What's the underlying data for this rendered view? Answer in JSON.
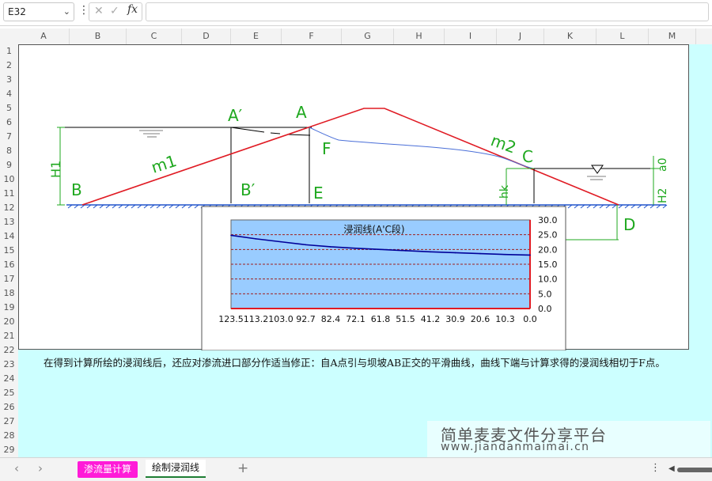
{
  "formula_bar": {
    "name_box": "E32",
    "fx": "fx",
    "cancel": "✕",
    "confirm": "✓",
    "more": "⋮",
    "content": ""
  },
  "columns": [
    "A",
    "B",
    "C",
    "D",
    "E",
    "F",
    "G",
    "H",
    "I",
    "J",
    "K",
    "L",
    "M"
  ],
  "rows": [
    "1",
    "2",
    "3",
    "4",
    "5",
    "6",
    "7",
    "8",
    "9",
    "10",
    "11",
    "12",
    "13",
    "14",
    "15",
    "16",
    "17",
    "18",
    "19",
    "20",
    "21",
    "22",
    "23",
    "24",
    "25",
    "26",
    "27",
    "28",
    "29"
  ],
  "diagram": {
    "labels": {
      "A_prime": "A′",
      "A": "A",
      "B": "B",
      "B_prime": "B′",
      "E": "E",
      "F": "F",
      "m1": "m1",
      "m2": "m2",
      "C": "C",
      "D": "D",
      "H1": "H1",
      "H2": "H2",
      "hk": "hk",
      "a0": "a0"
    },
    "colors": {
      "slope": "#e01b24",
      "seepage": "#4a6fd8",
      "annotation": "#1fa81f",
      "water": "#2255cc"
    }
  },
  "chart_data": {
    "type": "line",
    "title": "浸润线(A'C段)",
    "categories": [
      "123.5",
      "113.2",
      "103.0",
      "92.7",
      "82.4",
      "72.1",
      "61.8",
      "51.5",
      "41.2",
      "30.9",
      "20.6",
      "10.3",
      "0.0"
    ],
    "x": [
      123.5,
      113.2,
      103.0,
      92.7,
      82.4,
      72.1,
      61.8,
      51.5,
      41.2,
      30.9,
      20.6,
      10.3,
      0.0
    ],
    "series": [
      {
        "values": [
          24.8,
          23.6,
          22.6,
          21.6,
          20.9,
          20.4,
          20.0,
          19.6,
          19.2,
          18.9,
          18.6,
          18.3,
          18.1
        ]
      }
    ],
    "yticks": [
      "30.0",
      "25.0",
      "20.0",
      "15.0",
      "10.0",
      "5.0",
      "0.0"
    ],
    "ylim": [
      0,
      30
    ],
    "y_axis_side": "right",
    "grid": true,
    "plot_bg": "#99ccff",
    "line_color": "#000099",
    "grid_color": "#a02020"
  },
  "note": "在得到计算所绘的浸润线后，还应对渗流进口部分作适当修正：自A点引与坝坡AB正交的平滑曲线，曲线下端与计算求得的浸润线相切于F点。",
  "watermark": {
    "title": "简单麦麦文件分享平台",
    "url": "www.jiandanmaimai.cn"
  },
  "tabs": [
    {
      "label": "渗流量计算",
      "color": "#ff1bd8"
    },
    {
      "label": "绘制浸润线"
    }
  ],
  "tab_nav": {
    "prev": "‹",
    "next": "›",
    "add": "+"
  },
  "scroll": {
    "more": "⋮",
    "left_arrow": "◀"
  }
}
